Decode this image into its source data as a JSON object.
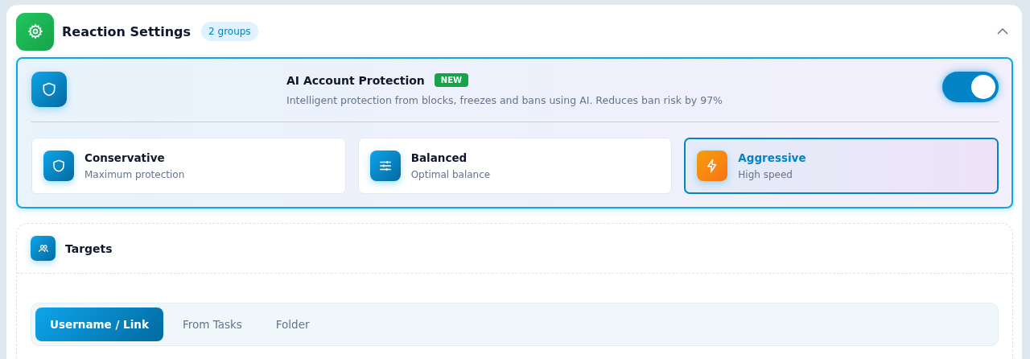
{
  "header": {
    "title": "Reaction Settings",
    "badge": "2 groups",
    "expanded": true
  },
  "protection": {
    "title": "AI Account Protection",
    "tag": "NEW",
    "description": "Intelligent protection from blocks, freezes and bans using AI. Reduces ban risk by 97%",
    "on": true,
    "modes": [
      {
        "kind": "shield",
        "title": "Conservative",
        "subtitle": "Maximum protection",
        "selected": false
      },
      {
        "kind": "sliders",
        "title": "Balanced",
        "subtitle": "Optimal balance",
        "selected": false
      },
      {
        "kind": "bolt",
        "title": "Aggressive",
        "subtitle": "High speed",
        "selected": true
      }
    ]
  },
  "targets": {
    "title": "Targets",
    "tabs": [
      {
        "label": "Username / Link",
        "selected": true
      },
      {
        "label": "From Tasks",
        "selected": false
      },
      {
        "label": "Folder",
        "selected": false
      }
    ]
  }
}
